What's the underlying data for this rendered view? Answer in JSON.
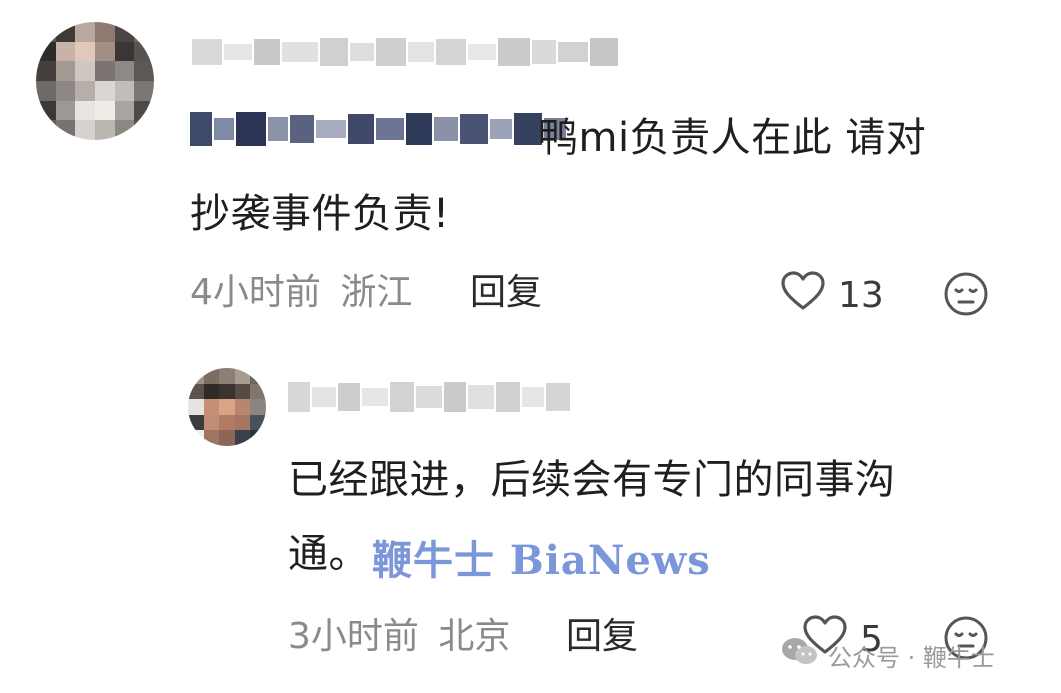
{
  "comment": {
    "username_redacted": "█████████",
    "reply_target_redacted": "████████",
    "text_line1": "鸭mi负责人在此 请对",
    "text_line2": "抄袭事件负责!",
    "time": "4小时前",
    "location": "浙江",
    "reply_label": "回复",
    "likes": "13"
  },
  "reply": {
    "username_redacted": "████████",
    "text_line1": "已经跟进，后续会有专门的同事沟",
    "text_line2": "通。",
    "time": "3小时前",
    "location": "北京",
    "reply_label": "回复",
    "likes": "5"
  },
  "overlays": {
    "bianews_watermark": "鞭牛士 BiaNews",
    "wechat_watermark": "公众号 · 鞭牛士"
  },
  "colors": {
    "watermark_blue": "#7b96d9",
    "meta_gray": "#8a8a8a",
    "icon_gray": "#555555"
  },
  "icons": [
    "heart-outline-icon",
    "expressionless-face-icon",
    "wechat-logo-icon"
  ]
}
